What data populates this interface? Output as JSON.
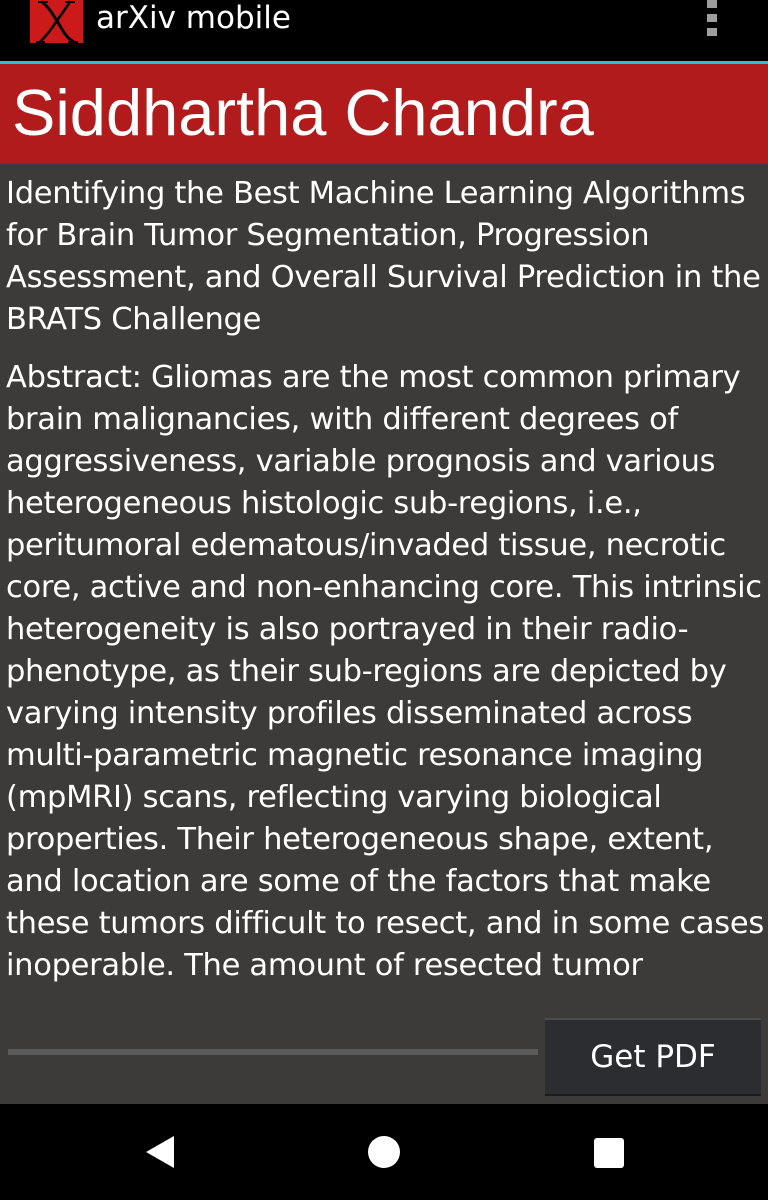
{
  "app": {
    "title": "arXiv mobile",
    "logo_letter": "X",
    "logo_color": "#cc1a1a",
    "menu_icon": "overflow-menu-icon"
  },
  "author": {
    "name": "Siddhartha Chandra",
    "banner_color": "#b21b1b"
  },
  "paper": {
    "title": "Identifying the Best Machine Learning Algorithms for Brain Tumor Segmentation, Progression Assessment, and Overall Survival Prediction in the BRATS Challenge",
    "abstract": "Abstract:   Gliomas are the most common primary brain malignancies, with different degrees of aggressiveness, variable prognosis and various heterogeneous histologic sub-regions, i.e., peritumoral edematous/invaded tissue, necrotic core, active and non-enhancing core. This intrinsic heterogeneity is also portrayed in their radio-phenotype, as their sub-regions are depicted by varying intensity profiles disseminated across multi-parametric magnetic resonance imaging (mpMRI) scans, reflecting varying biological properties. Their heterogeneous shape, extent, and location are some of the factors that make these tumors difficult to resect, and in some cases inoperable. The amount of resected tumor"
  },
  "download": {
    "button_label": "Get PDF",
    "progress": 0
  },
  "navbar": {
    "back_icon": "back-icon",
    "home_icon": "home-icon",
    "recents_icon": "recents-icon"
  },
  "colors": {
    "background": "#3c3b39",
    "accent_divider": "#33b5e5",
    "button": "#2b2d31"
  }
}
